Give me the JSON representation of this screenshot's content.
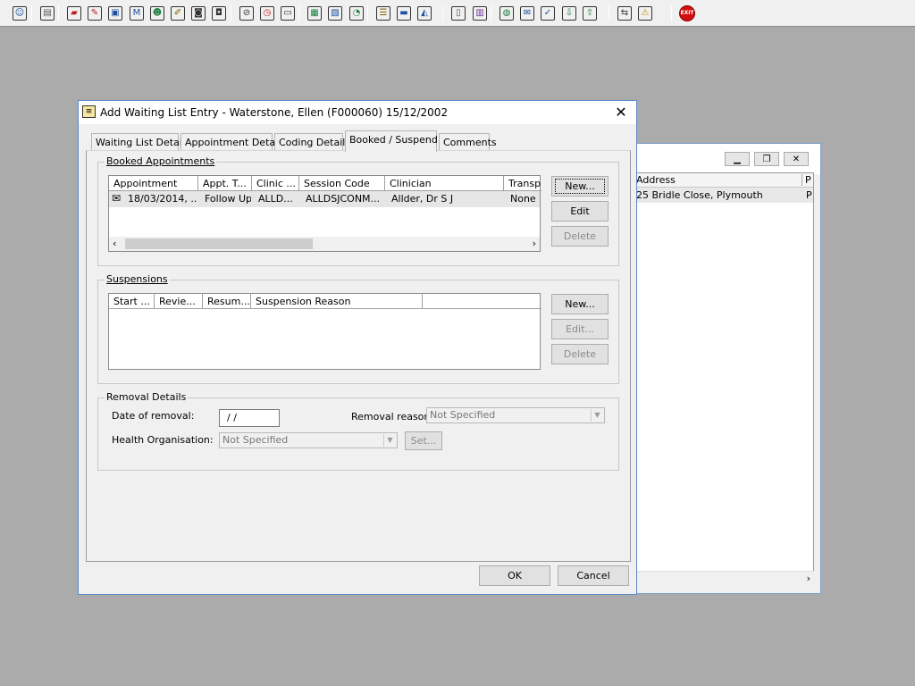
{
  "toolbar": {
    "icons": [
      {
        "name": "user-icon",
        "glyph": "☺",
        "color": "#1a4fa0"
      },
      {
        "name": "print-icon",
        "glyph": "▤",
        "color": "#555"
      },
      {
        "name": "book-icon",
        "glyph": "▰",
        "color": "#c02020"
      },
      {
        "name": "edit-icon",
        "glyph": "✎",
        "color": "#c02020"
      },
      {
        "name": "card-icon",
        "glyph": "▣",
        "color": "#1a4fa0"
      },
      {
        "name": "mail-icon",
        "glyph": "M",
        "color": "#1a4fa0"
      },
      {
        "name": "person-icon",
        "glyph": "☻",
        "color": "#1a8040"
      },
      {
        "name": "note-icon",
        "glyph": "✐",
        "color": "#806000"
      },
      {
        "name": "camera-icon",
        "glyph": "◙",
        "color": "#333"
      },
      {
        "name": "video-icon",
        "glyph": "◘",
        "color": "#333"
      },
      {
        "name": "no-entry-icon",
        "glyph": "⊘",
        "color": "#333"
      },
      {
        "name": "clock-icon",
        "glyph": "◷",
        "color": "#c02020"
      },
      {
        "name": "monitor-icon",
        "glyph": "▭",
        "color": "#333"
      },
      {
        "name": "report-icon",
        "glyph": "▦",
        "color": "#1a8040"
      },
      {
        "name": "form-icon",
        "glyph": "▧",
        "color": "#1a4fa0"
      },
      {
        "name": "schedule-icon",
        "glyph": "◔",
        "color": "#1a8040"
      },
      {
        "name": "list-icon",
        "glyph": "☰",
        "color": "#806000"
      },
      {
        "name": "bed-icon",
        "glyph": "▬",
        "color": "#1a4fa0"
      },
      {
        "name": "transport-icon",
        "glyph": "◭",
        "color": "#1a4fa0"
      },
      {
        "name": "document-icon",
        "glyph": "▯",
        "color": "#555"
      },
      {
        "name": "chart-icon",
        "glyph": "▥",
        "color": "#7030a0"
      },
      {
        "name": "globe-icon",
        "glyph": "◍",
        "color": "#1a8040"
      },
      {
        "name": "letter-icon",
        "glyph": "✉",
        "color": "#1a4fa0"
      },
      {
        "name": "check-form-icon",
        "glyph": "✓",
        "color": "#1a4fa0"
      },
      {
        "name": "download-icon",
        "glyph": "⇩",
        "color": "#1a8040"
      },
      {
        "name": "upload-icon",
        "glyph": "⇧",
        "color": "#1a8040"
      },
      {
        "name": "transfer-icon",
        "glyph": "⇆",
        "color": "#333"
      },
      {
        "name": "warning-icon",
        "glyph": "⚠",
        "color": "#c09000"
      },
      {
        "name": "exit-icon",
        "glyph": "EXIT",
        "color": "#ffffff"
      }
    ]
  },
  "background_window": {
    "columns": [
      "Address",
      "P"
    ],
    "row": [
      "25 Bridle Close, Plymouth",
      "P"
    ]
  },
  "dialog": {
    "title": "Add Waiting List Entry - Waterstone, Ellen (F000060) 15/12/2002",
    "tabs": [
      "Waiting List Details",
      "Appointment Details",
      "Coding Details",
      "Booked / Suspend",
      "Comments"
    ],
    "active_tab": "Booked / Suspend",
    "booked": {
      "label": "Booked Appointments",
      "columns": [
        "Appointment",
        "Appt. T...",
        "Clinic ...",
        "Session Code",
        "Clinician",
        "Transp"
      ],
      "rows": [
        [
          "18/03/2014, ...",
          "Follow Up",
          "ALLD...",
          "ALLDSJCONM...",
          "Allder, Dr S J",
          "None"
        ]
      ],
      "buttons": {
        "new": "New...",
        "edit": "Edit",
        "delete": "Delete"
      }
    },
    "suspensions": {
      "label": "Suspensions",
      "columns": [
        "Start ...",
        "Revie...",
        "Resum...",
        "Suspension Reason",
        ""
      ],
      "buttons": {
        "new": "New...",
        "edit": "Edit...",
        "delete": "Delete"
      }
    },
    "removal": {
      "label": "Removal Details",
      "date_label": "Date of removal:",
      "date_value": " /  /",
      "reason_label": "Removal reason:",
      "reason_value": "Not Specified",
      "org_label": "Health Organisation:",
      "org_value": "Not Specified",
      "set_button": "Set..."
    },
    "ok": "OK",
    "cancel": "Cancel"
  }
}
